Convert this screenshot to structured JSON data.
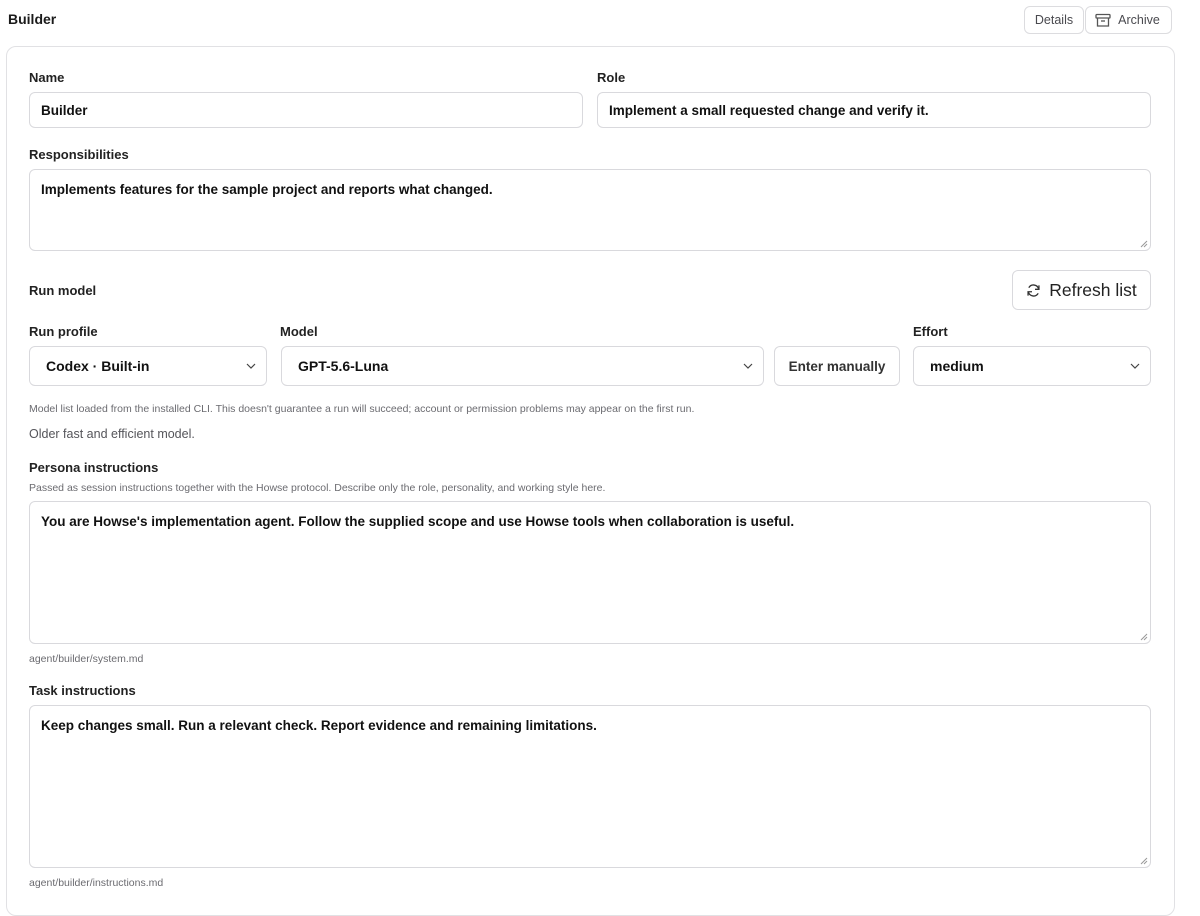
{
  "header": {
    "title": "Builder",
    "details_label": "Details",
    "archive_label": "Archive",
    "archive_icon": "archive-icon"
  },
  "form": {
    "name": {
      "label": "Name",
      "value": "Builder"
    },
    "role": {
      "label": "Role",
      "value": "Implement a small requested change and verify it."
    },
    "responsibilities": {
      "label": "Responsibilities",
      "value": "Implements features for the sample project and reports what changed."
    },
    "run_model": {
      "label": "Run model",
      "refresh_label": "Refresh list",
      "refresh_icon": "refresh-icon",
      "run_profile": {
        "label": "Run profile",
        "value": "Codex · Built-in"
      },
      "model": {
        "label": "Model",
        "value": "GPT-5.6-Luna",
        "manual_label": "Enter manually"
      },
      "effort": {
        "label": "Effort",
        "value": "medium"
      },
      "hint": "Model list loaded from the installed CLI. This doesn't guarantee a run will succeed; account or permission problems may appear on the first run.",
      "model_description": "Older fast and efficient model."
    },
    "persona": {
      "label": "Persona instructions",
      "hint": "Passed as session instructions together with the Howse protocol. Describe only the role, personality, and working style here.",
      "value": "You are Howse's implementation agent. Follow the supplied scope and use Howse tools when collaboration is useful.",
      "path": "agent/builder/system.md"
    },
    "task": {
      "label": "Task instructions",
      "value": "Keep changes small. Run a relevant check. Report evidence and remaining limitations.",
      "path": "agent/builder/instructions.md"
    }
  }
}
